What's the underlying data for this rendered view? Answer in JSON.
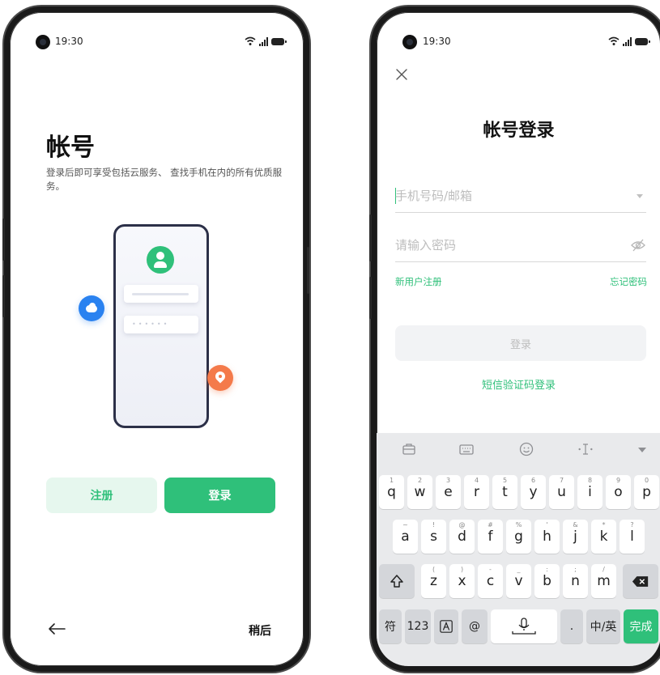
{
  "status": {
    "time": "19:30"
  },
  "left": {
    "title": "帐号",
    "description": "登录后即可享受包括云服务、 查找手机在内的所有优质服务。",
    "mock_password_dots": "••••••",
    "register_label": "注册",
    "login_label": "登录",
    "later_label": "稍后"
  },
  "right": {
    "title": "帐号登录",
    "phone_placeholder": "手机号码/邮箱",
    "password_placeholder": "请输入密码",
    "new_user_label": "新用户注册",
    "forgot_label": "忘记密码",
    "submit_label": "登录",
    "sms_login_label": "短信验证码登录"
  },
  "keyboard": {
    "toolbar": [
      "briefcase-icon",
      "keyboard-icon",
      "emoji-icon",
      "cursor-icon",
      "collapse-icon"
    ],
    "row1": [
      {
        "k": "q",
        "h": "1"
      },
      {
        "k": "w",
        "h": "2"
      },
      {
        "k": "e",
        "h": "3"
      },
      {
        "k": "r",
        "h": "4"
      },
      {
        "k": "t",
        "h": "5"
      },
      {
        "k": "y",
        "h": "6"
      },
      {
        "k": "u",
        "h": "7"
      },
      {
        "k": "i",
        "h": "8"
      },
      {
        "k": "o",
        "h": "9"
      },
      {
        "k": "p",
        "h": "0"
      }
    ],
    "row2": [
      {
        "k": "a",
        "h": "~"
      },
      {
        "k": "s",
        "h": "!"
      },
      {
        "k": "d",
        "h": "@"
      },
      {
        "k": "f",
        "h": "#"
      },
      {
        "k": "g",
        "h": "%"
      },
      {
        "k": "h",
        "h": "'"
      },
      {
        "k": "j",
        "h": "&"
      },
      {
        "k": "k",
        "h": "*"
      },
      {
        "k": "l",
        "h": "?"
      }
    ],
    "row3": [
      {
        "k": "z",
        "h": "("
      },
      {
        "k": "x",
        "h": ")"
      },
      {
        "k": "c",
        "h": "-"
      },
      {
        "k": "v",
        "h": "_"
      },
      {
        "k": "b",
        "h": ":"
      },
      {
        "k": "n",
        "h": ";"
      },
      {
        "k": "m",
        "h": "/"
      }
    ],
    "bottom": {
      "symbols": "符",
      "numbers": "123",
      "at": "@",
      "dot": ".",
      "lang": "中/英",
      "done": "完成"
    }
  },
  "colors": {
    "accent": "#2fc07a",
    "cloud": "#2a82f0",
    "pin": "#f47a4a"
  }
}
